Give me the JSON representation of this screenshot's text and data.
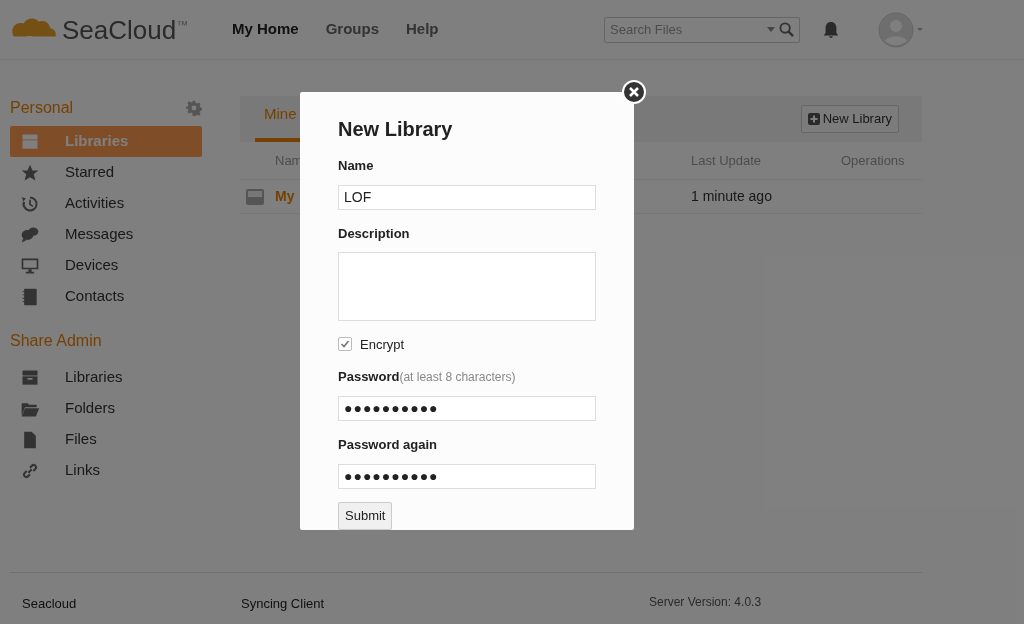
{
  "header": {
    "logo": {
      "name": "SeaCloud",
      "mark": "™"
    },
    "nav": [
      {
        "label": "My Home",
        "selected": true
      },
      {
        "label": "Groups",
        "selected": false
      },
      {
        "label": "Help",
        "selected": false
      }
    ],
    "search": {
      "placeholder": "Search Files"
    }
  },
  "sidebar": {
    "sections": [
      {
        "title": "Personal",
        "has_settings": true,
        "items": [
          {
            "label": "Libraries",
            "kind": "archive",
            "selected": true
          },
          {
            "label": "Starred",
            "kind": "star",
            "selected": false
          },
          {
            "label": "Activities",
            "kind": "history",
            "selected": false
          },
          {
            "label": "Messages",
            "kind": "chat",
            "selected": false
          },
          {
            "label": "Devices",
            "kind": "monitor",
            "selected": false
          },
          {
            "label": "Contacts",
            "kind": "book",
            "selected": false
          }
        ]
      },
      {
        "title": "Share Admin",
        "has_settings": false,
        "items": [
          {
            "label": "Libraries",
            "kind": "archive",
            "selected": false
          },
          {
            "label": "Folders",
            "kind": "folder",
            "selected": false
          },
          {
            "label": "Files",
            "kind": "file",
            "selected": false
          },
          {
            "label": "Links",
            "kind": "link",
            "selected": false
          }
        ]
      }
    ]
  },
  "main": {
    "tabs": [
      {
        "label": "Mine",
        "selected": true
      }
    ],
    "new_button": "New Library",
    "columns": [
      "Nam",
      "Last Update",
      "Operations"
    ],
    "rows": [
      {
        "name": "My",
        "updated": "1 minute ago"
      }
    ]
  },
  "dialog": {
    "title": "New Library",
    "name_label": "Name",
    "name_value": "LOF",
    "description_label": "Description",
    "encrypt": {
      "label": "Encrypt",
      "checked": true
    },
    "password_label": "Password",
    "password_hint": "(at least 8 characters)",
    "password_mask": "●●●●●●●●●●",
    "password_again_label": "Password again",
    "password_again_mask": "●●●●●●●●●●",
    "submit": "Submit"
  },
  "footer": {
    "brand": "Seacloud",
    "link": "Syncing Client",
    "version": "Server Version: 4.0.3"
  }
}
